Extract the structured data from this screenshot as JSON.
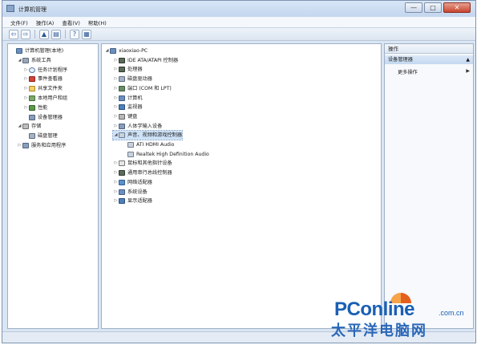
{
  "window": {
    "title": "计算机管理",
    "min_label": "—",
    "max_label": "□",
    "close_label": "✕"
  },
  "menu": [
    "文件(F)",
    "操作(A)",
    "查看(V)",
    "帮助(H)"
  ],
  "toolbar": {
    "back": "⇦",
    "forward": "⇨",
    "up": "▲",
    "props": "▤",
    "help": "?",
    "view": "▦"
  },
  "left_tree": [
    {
      "label": "计算机管理(本地)",
      "icon": "computer-icon",
      "exp": "",
      "level": 0
    },
    {
      "label": "系统工具",
      "icon": "tools-icon",
      "exp": "◢",
      "level": 1
    },
    {
      "label": "任务计划程序",
      "icon": "clock-icon",
      "exp": "▷",
      "level": 2
    },
    {
      "label": "事件查看器",
      "icon": "event-icon",
      "exp": "▷",
      "level": 2
    },
    {
      "label": "共享文件夹",
      "icon": "folder-icon",
      "exp": "▷",
      "level": 2
    },
    {
      "label": "本地用户和组",
      "icon": "users-icon",
      "exp": "▷",
      "level": 2
    },
    {
      "label": "性能",
      "icon": "performance-icon",
      "exp": "▷",
      "level": 2
    },
    {
      "label": "设备管理器",
      "icon": "device-manager-icon",
      "exp": "",
      "level": 2
    },
    {
      "label": "存储",
      "icon": "storage-icon",
      "exp": "◢",
      "level": 1
    },
    {
      "label": "磁盘管理",
      "icon": "disk-icon",
      "exp": "",
      "level": 2
    },
    {
      "label": "服务和应用程序",
      "icon": "services-icon",
      "exp": "▷",
      "level": 1
    }
  ],
  "device_tree": [
    {
      "label": "xiaoxiao-PC",
      "icon": "computer-icon",
      "exp": "◢",
      "level": 0
    },
    {
      "label": "IDE ATA/ATAPI 控制器",
      "icon": "chip-icon",
      "exp": "▷",
      "level": 1
    },
    {
      "label": "处理器",
      "icon": "chip-icon",
      "exp": "▷",
      "level": 1
    },
    {
      "label": "磁盘驱动器",
      "icon": "disk-icon",
      "exp": "▷",
      "level": 1
    },
    {
      "label": "端口 (COM 和 LPT)",
      "icon": "port-icon",
      "exp": "▷",
      "level": 1
    },
    {
      "label": "计算机",
      "icon": "computer-icon",
      "exp": "▷",
      "level": 1
    },
    {
      "label": "监视器",
      "icon": "monitor-icon",
      "exp": "▷",
      "level": 1
    },
    {
      "label": "键盘",
      "icon": "keyboard-icon",
      "exp": "▷",
      "level": 1
    },
    {
      "label": "人体学输入设备",
      "icon": "device-icon",
      "exp": "▷",
      "level": 1
    },
    {
      "label": "声音、视频和游戏控制器",
      "icon": "audio-icon",
      "exp": "◢",
      "level": 1,
      "selected": true
    },
    {
      "label": "ATI HDMI Audio",
      "icon": "audio-icon",
      "exp": "",
      "level": 2
    },
    {
      "label": "Realtek High Definition Audio",
      "icon": "audio-icon",
      "exp": "",
      "level": 2
    },
    {
      "label": "鼠标和其他指针设备",
      "icon": "mouse-icon",
      "exp": "▷",
      "level": 1
    },
    {
      "label": "通用串行总线控制器",
      "icon": "chip-icon",
      "exp": "▷",
      "level": 1
    },
    {
      "label": "网络适配器",
      "icon": "network-icon",
      "exp": "▷",
      "level": 1
    },
    {
      "label": "系统设备",
      "icon": "computer-icon",
      "exp": "▷",
      "level": 1
    },
    {
      "label": "显示适配器",
      "icon": "monitor-icon",
      "exp": "▷",
      "level": 1
    }
  ],
  "actions": {
    "header": "操作",
    "section": "设备管理器",
    "section_arrow": "▲",
    "more": "更多操作",
    "more_arrow": "▶"
  },
  "watermark": {
    "brand": "PConline",
    "domain": ".com.cn",
    "chinese": "太平洋电脑网"
  },
  "colors": {
    "accent": "#1a5fb4",
    "window_frame": "#dbe6f3",
    "selection": "#cfe3f8"
  }
}
